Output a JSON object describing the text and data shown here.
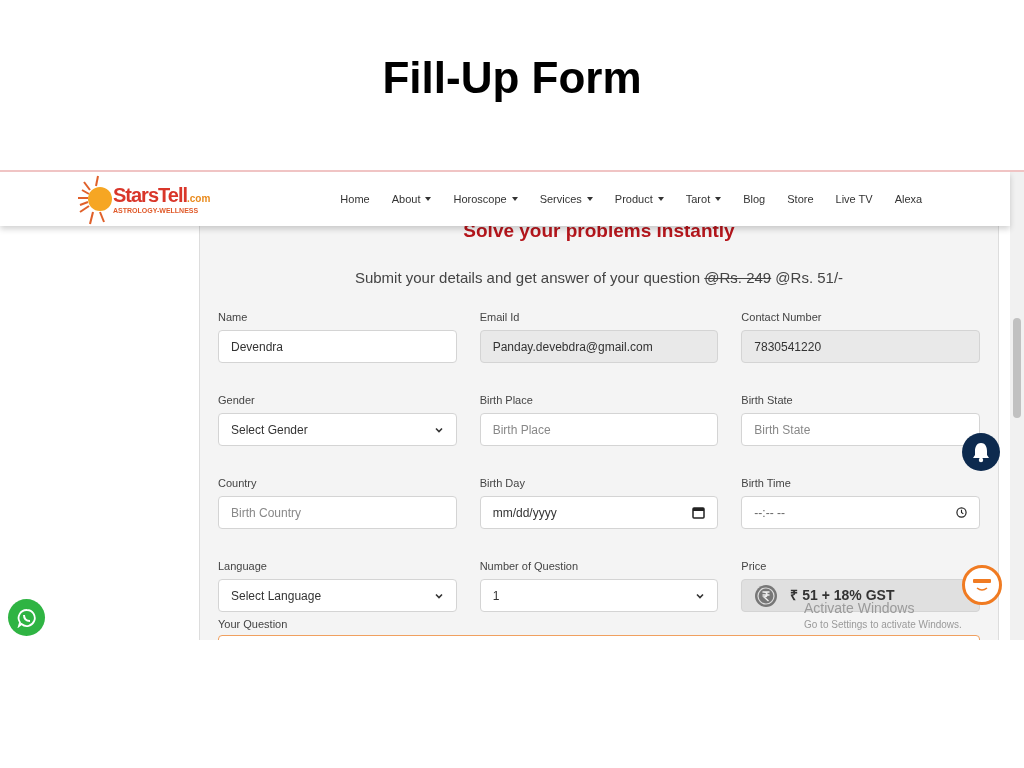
{
  "slide_title": "Fill-Up Form",
  "logo": {
    "name": "StarsTell",
    "suffix": ".com",
    "tagline": "ASTROLOGY-WELLNESS"
  },
  "nav": [
    {
      "label": "Home",
      "dropdown": false
    },
    {
      "label": "About",
      "dropdown": true
    },
    {
      "label": "Horoscope",
      "dropdown": true
    },
    {
      "label": "Services",
      "dropdown": true
    },
    {
      "label": "Product",
      "dropdown": true
    },
    {
      "label": "Tarot",
      "dropdown": true
    },
    {
      "label": "Blog",
      "dropdown": false
    },
    {
      "label": "Store",
      "dropdown": false
    },
    {
      "label": "Live TV",
      "dropdown": false
    },
    {
      "label": "Alexa",
      "dropdown": false
    }
  ],
  "heading": "Solve your problems instantly",
  "subtitle": {
    "text": "Submit your details and get answer of your question",
    "old_price": "@Rs. 249",
    "new_price": "@Rs. 51/-"
  },
  "fields": [
    {
      "label": "Name",
      "kind": "text",
      "value": "Devendra",
      "disabled": false
    },
    {
      "label": "Email Id",
      "kind": "text",
      "value": "Panday.devebdra@gmail.com",
      "disabled": true
    },
    {
      "label": "Contact Number",
      "kind": "text",
      "value": "7830541220",
      "disabled": true
    },
    {
      "label": "Gender",
      "kind": "select",
      "value": "Select Gender",
      "disabled": false
    },
    {
      "label": "Birth Place",
      "kind": "text",
      "placeholder": "Birth Place",
      "disabled": false
    },
    {
      "label": "Birth State",
      "kind": "text",
      "placeholder": "Birth State",
      "disabled": false
    },
    {
      "label": "Country",
      "kind": "text",
      "placeholder": "Birth Country",
      "disabled": false
    },
    {
      "label": "Birth Day",
      "kind": "date",
      "value": "mm/dd/yyyy",
      "disabled": false
    },
    {
      "label": "Birth Time",
      "kind": "time",
      "value": "--:-- --",
      "disabled": false
    },
    {
      "label": "Language",
      "kind": "select",
      "value": "Select Language",
      "disabled": false
    },
    {
      "label": "Number of Question",
      "kind": "select",
      "value": "1",
      "disabled": false
    },
    {
      "label": "Price",
      "kind": "price",
      "value": "₹ 51 + 18% GST",
      "disabled": true
    }
  ],
  "question": {
    "label": "Your Question"
  },
  "os_notice": {
    "title": "Activate Windows",
    "text": "Go to Settings to activate Windows."
  }
}
